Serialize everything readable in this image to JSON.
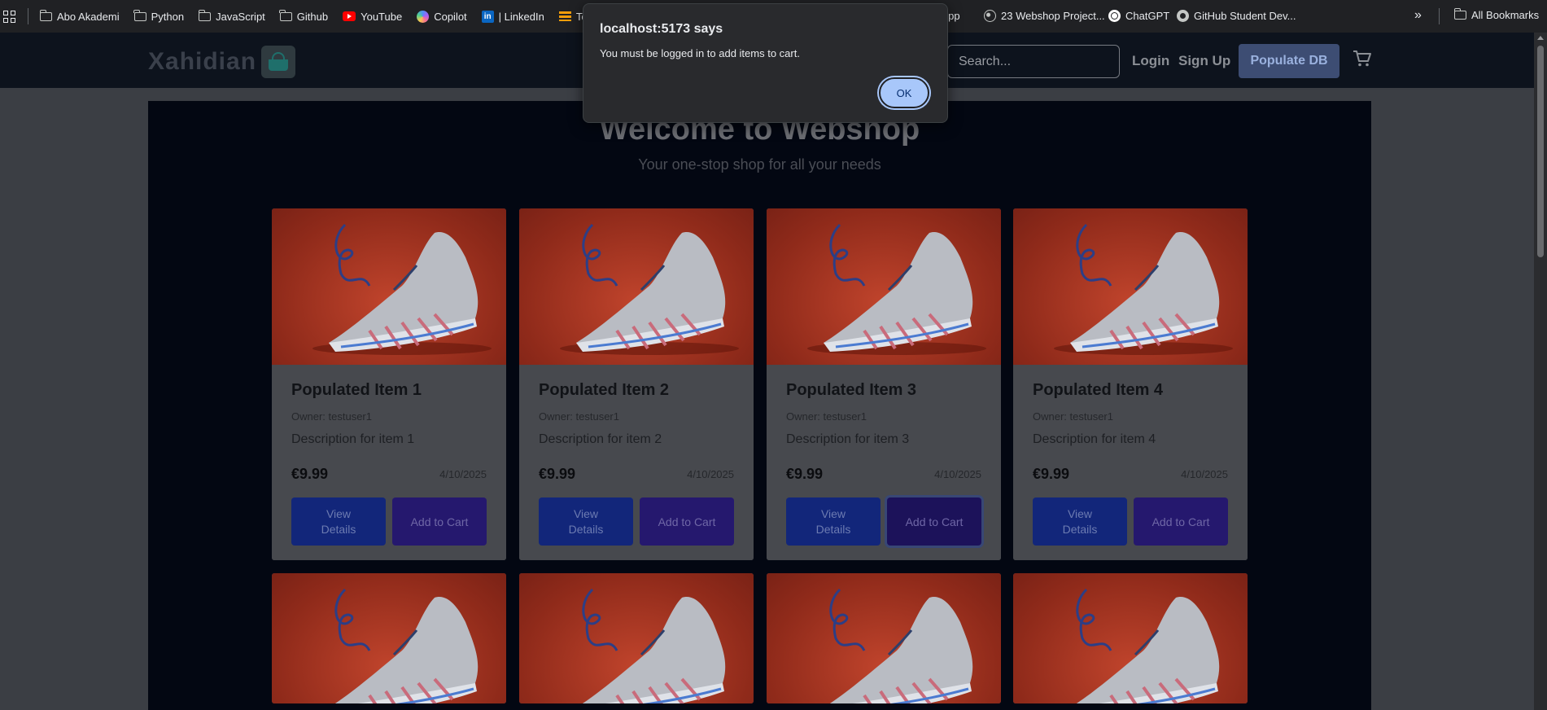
{
  "bookmarks": {
    "items": [
      {
        "label": "Abo Akademi",
        "icon": "folder-icon"
      },
      {
        "label": "Python",
        "icon": "folder-icon"
      },
      {
        "label": "JavaScript",
        "icon": "folder-icon"
      },
      {
        "label": "Github",
        "icon": "folder-icon"
      },
      {
        "label": "YouTube",
        "icon": "youtube-icon"
      },
      {
        "label": "Copilot",
        "icon": "copilot-icon"
      },
      {
        "label": "| LinkedIn",
        "icon": "linkedin-icon"
      },
      {
        "label": "Tensor",
        "icon": "tensorflow-icon"
      },
      {
        "label": "sApp",
        "icon": "none"
      },
      {
        "label": "23 Webshop Project...",
        "icon": "globe-icon"
      },
      {
        "label": "ChatGPT",
        "icon": "chatgpt-icon"
      },
      {
        "label": "GitHub Student Dev...",
        "icon": "github-icon"
      }
    ],
    "more": "»",
    "all_bookmarks": "All Bookmarks"
  },
  "header": {
    "logo_text": "Xahidian",
    "search_placeholder": "Search...",
    "login": "Login",
    "signup": "Sign Up",
    "populate": "Populate DB"
  },
  "hero": {
    "title": "Welcome to Webshop",
    "subtitle": "Your one-stop shop for all your needs"
  },
  "products": [
    {
      "title": "Populated Item 1",
      "owner": "Owner: testuser1",
      "description": "Description for item 1",
      "price": "€9.99",
      "date": "4/10/2025",
      "details_label": "View Details",
      "cart_label": "Add to Cart"
    },
    {
      "title": "Populated Item 2",
      "owner": "Owner: testuser1",
      "description": "Description for item 2",
      "price": "€9.99",
      "date": "4/10/2025",
      "details_label": "View Details",
      "cart_label": "Add to Cart"
    },
    {
      "title": "Populated Item 3",
      "owner": "Owner: testuser1",
      "description": "Description for item 3",
      "price": "€9.99",
      "date": "4/10/2025",
      "details_label": "View Details",
      "cart_label": "Add to Cart"
    },
    {
      "title": "Populated Item 4",
      "owner": "Owner: testuser1",
      "description": "Description for item 4",
      "price": "€9.99",
      "date": "4/10/2025",
      "details_label": "View Details",
      "cart_label": "Add to Cart"
    }
  ],
  "dialog": {
    "title": "localhost:5173 says",
    "message": "You must be logged in to add items to cart.",
    "ok": "OK"
  },
  "colors": {
    "accent": "#a8c7fa",
    "card_image": "#c0442c"
  }
}
